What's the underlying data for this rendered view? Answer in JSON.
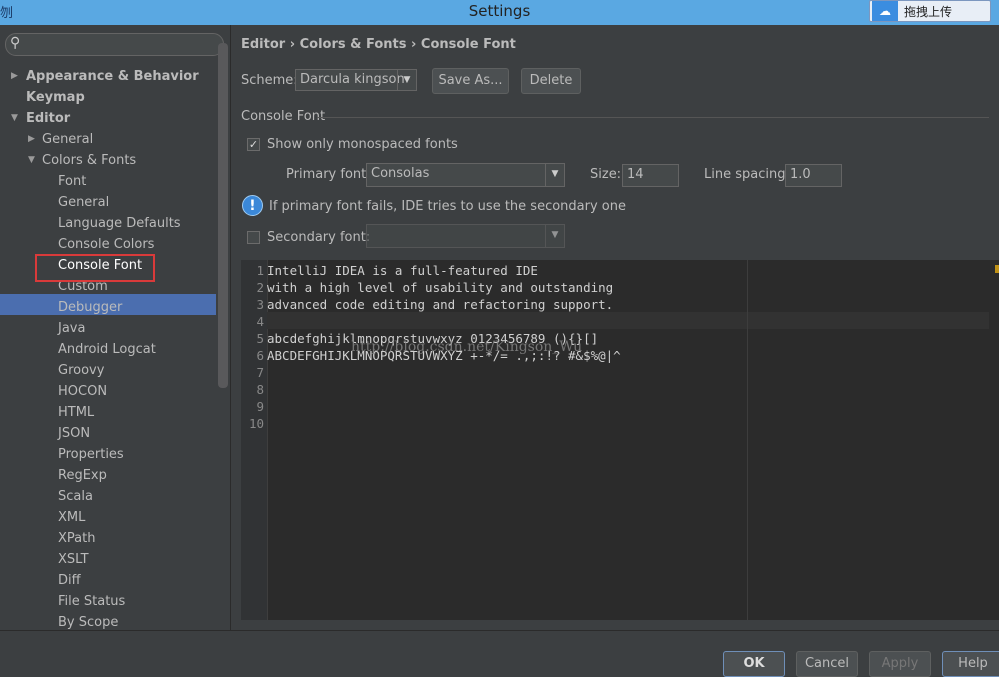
{
  "window": {
    "title": "Settings",
    "app_icon_glyph": "刎"
  },
  "upload_button": {
    "label": "拖拽上传",
    "icon": "cloud-icon"
  },
  "sidebar": {
    "search_placeholder": "",
    "items": [
      {
        "label": "Appearance & Behavior",
        "level": 0,
        "bold": true,
        "arrow": "right"
      },
      {
        "label": "Keymap",
        "level": 0,
        "bold": true,
        "arrow": ""
      },
      {
        "label": "Editor",
        "level": 0,
        "bold": true,
        "arrow": "down"
      },
      {
        "label": "General",
        "level": 1,
        "bold": false,
        "arrow": "right"
      },
      {
        "label": "Colors & Fonts",
        "level": 1,
        "bold": false,
        "arrow": "down"
      },
      {
        "label": "Font",
        "level": 2,
        "bold": false,
        "arrow": ""
      },
      {
        "label": "General",
        "level": 2,
        "bold": false,
        "arrow": ""
      },
      {
        "label": "Language Defaults",
        "level": 2,
        "bold": false,
        "arrow": ""
      },
      {
        "label": "Console Colors",
        "level": 2,
        "bold": false,
        "arrow": ""
      },
      {
        "label": "Console Font",
        "level": 2,
        "bold": false,
        "arrow": "",
        "selected": true
      },
      {
        "label": "Custom",
        "level": 2,
        "bold": false,
        "arrow": ""
      },
      {
        "label": "Debugger",
        "level": 2,
        "bold": false,
        "arrow": ""
      },
      {
        "label": "Java",
        "level": 2,
        "bold": false,
        "arrow": ""
      },
      {
        "label": "Android Logcat",
        "level": 2,
        "bold": false,
        "arrow": ""
      },
      {
        "label": "Groovy",
        "level": 2,
        "bold": false,
        "arrow": ""
      },
      {
        "label": "HOCON",
        "level": 2,
        "bold": false,
        "arrow": ""
      },
      {
        "label": "HTML",
        "level": 2,
        "bold": false,
        "arrow": ""
      },
      {
        "label": "JSON",
        "level": 2,
        "bold": false,
        "arrow": ""
      },
      {
        "label": "Properties",
        "level": 2,
        "bold": false,
        "arrow": ""
      },
      {
        "label": "RegExp",
        "level": 2,
        "bold": false,
        "arrow": ""
      },
      {
        "label": "Scala",
        "level": 2,
        "bold": false,
        "arrow": ""
      },
      {
        "label": "XML",
        "level": 2,
        "bold": false,
        "arrow": ""
      },
      {
        "label": "XPath",
        "level": 2,
        "bold": false,
        "arrow": ""
      },
      {
        "label": "XSLT",
        "level": 2,
        "bold": false,
        "arrow": ""
      },
      {
        "label": "Diff",
        "level": 2,
        "bold": false,
        "arrow": ""
      },
      {
        "label": "File Status",
        "level": 2,
        "bold": false,
        "arrow": ""
      },
      {
        "label": "By Scope",
        "level": 2,
        "bold": false,
        "arrow": ""
      }
    ]
  },
  "breadcrumb": {
    "text": "Editor › Colors & Fonts › Console Font"
  },
  "scheme": {
    "label": "Scheme:",
    "value": "Darcula kingson",
    "save_as": "Save As...",
    "delete": "Delete"
  },
  "console_font": {
    "section_title": "Console Font",
    "monospaced_label": "Show only monospaced fonts",
    "monospaced_checked": true,
    "primary_font_label": "Primary font:",
    "primary_font_value": "Consolas",
    "size_label": "Size:",
    "size_value": "14",
    "line_spacing_label": "Line spacing:",
    "line_spacing_value": "1.0",
    "info_text": "If primary font fails, IDE tries to use the secondary one",
    "secondary_font_label": "Secondary font:",
    "secondary_font_checked": false,
    "secondary_font_value": ""
  },
  "preview": {
    "line_numbers": [
      "1",
      "2",
      "3",
      "4",
      "5",
      "6",
      "7",
      "8",
      "9",
      "10"
    ],
    "lines": [
      "IntelliJ IDEA is a full-featured IDE",
      "with a high level of usability and outstanding",
      "advanced code editing and refactoring support.",
      "",
      "abcdefghijklmnopqrstuvwxyz 0123456789 (){}[]",
      "ABCDEFGHIJKLMNOPQRSTUVWXYZ +-*/= .,;:!? #&$%@|^"
    ],
    "watermark": "http://blog.csdn.net/Kingson_Wu"
  },
  "footer": {
    "ok": "OK",
    "cancel": "Cancel",
    "apply": "Apply",
    "help": "Help"
  }
}
